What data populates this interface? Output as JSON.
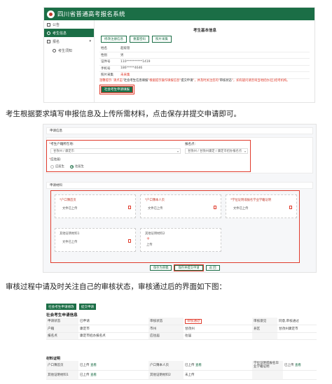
{
  "shot1": {
    "app_title": "四川省普通高考报名系统",
    "sidebar": {
      "notice": "公告",
      "student_info": "考生信息",
      "signup": "报名",
      "student_notice": "考生须知"
    },
    "heading": "考生基本信息",
    "buttons": [
      "修改注册信息",
      "重置密码",
      "照片采集"
    ],
    "fields": [
      {
        "label": "姓名",
        "value": "超级管"
      },
      {
        "label": "性别",
        "value": "男"
      },
      {
        "label": "证件号",
        "value": "110**********1419"
      },
      {
        "label": "手机号",
        "value": "186*****4646"
      },
      {
        "label": "照片采集",
        "value": "未采集"
      }
    ],
    "tip_prefix": "温馨提示: 请点击",
    "tip_mid1": "社会考生信息填报",
    "tip_mid2": "根据提示操作填报信息",
    "tip_mid3": "提交申请",
    "tip_mid4": "并及时关注您的",
    "tip_mid5": "审核状态",
    "tip_suffix": "如有疑问请咨询当地招办(区)招考机构。",
    "submit_button": "社会考生申请填报"
  },
  "caption1": "考生根据要求填写申报信息及上传所需材料，点击保存并提交申请即可。",
  "shot2": {
    "section_apply": "申请信息",
    "hukou_label": "考生户籍所在地:",
    "hukou_value": "甘孜州 / 康定市",
    "site_label": "报名点:",
    "site_value": "甘孜州 / 甘孜州康定 / 康定市招办报名点",
    "fresh_label": "应往届:",
    "radio1": "应届生",
    "radio2": "往届生",
    "section_materials": "申请材料",
    "cards": [
      {
        "title": "*户口簿首页",
        "status": "文件已上传"
      },
      {
        "title": "*户口簿本人页",
        "status": "文件已上传"
      },
      {
        "title": "*学位证明或报名学业学籍证明",
        "status": "文件已上传"
      },
      {
        "title": "其他证明材料1",
        "status": "文件已上传"
      },
      {
        "title": "其他证明材料2",
        "status": "上传"
      }
    ],
    "actions": [
      "保存为草稿",
      "保存并提交申请",
      "返 回"
    ]
  },
  "caption2": "审核过程中请及时关注自己的审核状态，审核通过后的界面如下图：",
  "shot3": {
    "tabs": [
      "社会考生申请修改",
      "提交申请"
    ],
    "title": "社会考生申请信息",
    "rows": [
      [
        "申请状态",
        "已申请",
        "审核状态",
        "审核通过",
        "审核意见",
        "同意,审核通过"
      ],
      [
        "户籍",
        "康定市",
        "市州",
        "甘孜州",
        "县区",
        "甘孜州康定市"
      ],
      [
        "报名点",
        "康定市招办报名点",
        "应往届",
        "往届",
        "",
        ""
      ]
    ],
    "materials_title": "材料证明",
    "materials": [
      [
        "户口簿首页",
        "已上传",
        "查看",
        "户口簿本人页",
        "已上传",
        "查看",
        "学位证明或报名毕业学籍证明",
        "已上传",
        "查看"
      ],
      [
        "其他证明材料1",
        "已上传",
        "查看",
        "其他证明材料2",
        "未上传",
        "",
        "",
        "",
        ""
      ]
    ]
  },
  "colors": {
    "brand_green": "#1b6e46",
    "highlight_red": "#e03b2c"
  }
}
